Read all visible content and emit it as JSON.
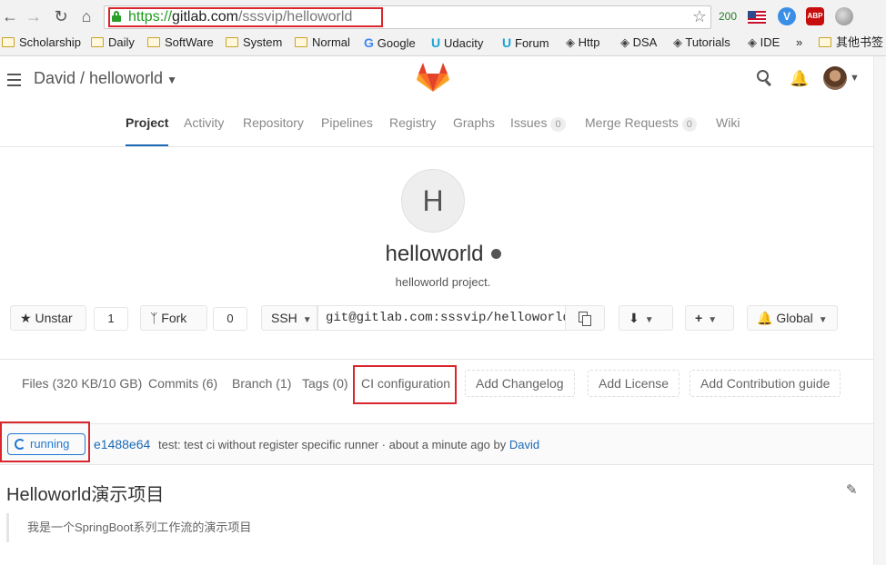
{
  "browser": {
    "url_https": "https://",
    "url_host": "gitlab.com",
    "url_path": "/sssvip/helloworld",
    "ext_count": "200",
    "abp_label": "ABP",
    "v_label": "V",
    "bookmarks": [
      {
        "label": "Scholarship",
        "icon": "folder"
      },
      {
        "label": "Daily",
        "icon": "folder"
      },
      {
        "label": "SoftWare",
        "icon": "folder"
      },
      {
        "label": "System",
        "icon": "folder"
      },
      {
        "label": "Normal",
        "icon": "folder"
      },
      {
        "label": "Google",
        "icon": "google"
      },
      {
        "label": "Udacity",
        "icon": "udacity"
      },
      {
        "label": "Forum",
        "icon": "udacity"
      },
      {
        "label": "Http",
        "icon": "diamond"
      },
      {
        "label": "DSA",
        "icon": "diamond"
      },
      {
        "label": "Tutorials",
        "icon": "diamond"
      },
      {
        "label": "IDE",
        "icon": "diamond"
      },
      {
        "label": "»",
        "icon": "none"
      },
      {
        "label": "其他书签",
        "icon": "folder"
      }
    ]
  },
  "header": {
    "breadcrumb": "David / helloworld"
  },
  "tabs": [
    {
      "label": "Project",
      "active": true
    },
    {
      "label": "Activity"
    },
    {
      "label": "Repository"
    },
    {
      "label": "Pipelines"
    },
    {
      "label": "Registry"
    },
    {
      "label": "Graphs"
    },
    {
      "label": "Issues",
      "badge": "0"
    },
    {
      "label": "Merge Requests",
      "badge": "0"
    },
    {
      "label": "Wiki"
    }
  ],
  "project": {
    "avatar_letter": "H",
    "name": "helloworld",
    "description": "helloworld project.",
    "unstar_label": "Unstar",
    "star_count": "1",
    "fork_label": "Fork",
    "fork_count": "0",
    "protocol": "SSH",
    "clone_url": "git@gitlab.com:sssvip/helloworld.",
    "notification": "Global"
  },
  "stats": {
    "files": "Files (320 KB/10 GB)",
    "commits": "Commits (6)",
    "branch": "Branch (1)",
    "tags": "Tags (0)",
    "ci": "CI configuration",
    "add_changelog": "Add Changelog",
    "add_license": "Add License",
    "add_contribution": "Add Contribution guide"
  },
  "commit": {
    "status": "running",
    "sha": "e1488e64",
    "message": "test: test ci without register specific runner · about a minute ago by",
    "author": "David"
  },
  "readme": {
    "title": "Helloworld演示项目",
    "quote": "我是一个SpringBoot系列工作流的演示项目"
  },
  "colors": {
    "link": "#1b69b6",
    "highlight": "#d9262c",
    "running": "#1f78d1"
  }
}
